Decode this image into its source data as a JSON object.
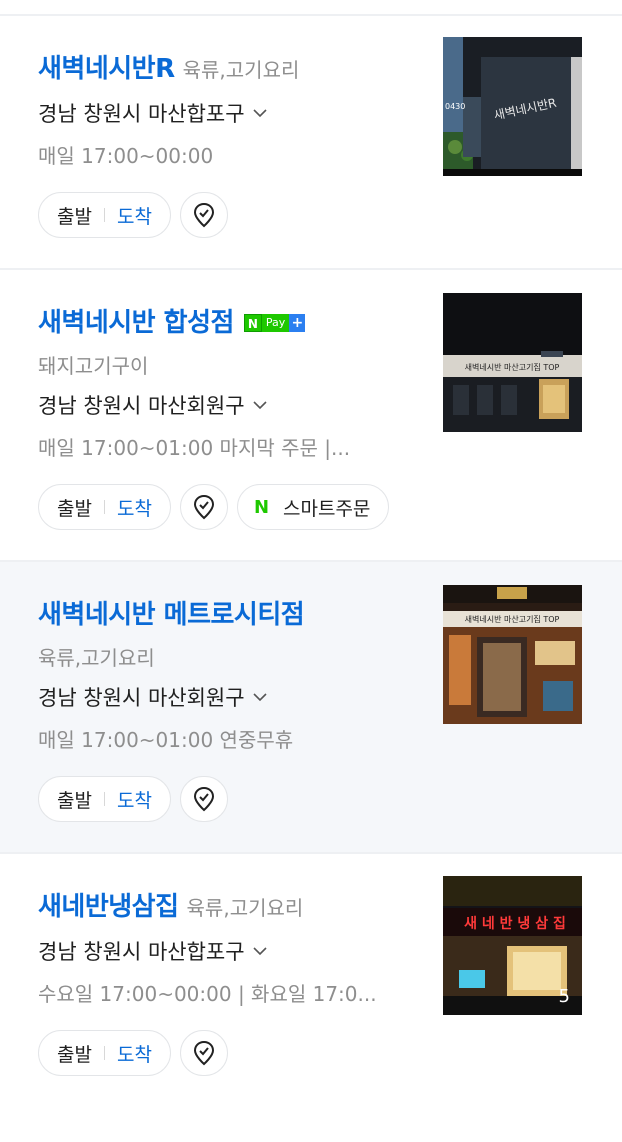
{
  "results": [
    {
      "name": "새벽네시반R",
      "category": "육류,고기요리",
      "address": "경남 창원시 마산합포구",
      "hours": "매일 17:00~00:00",
      "buttons": {
        "start": "출발",
        "arrive": "도착"
      },
      "thumbnail": {
        "sign_text": "새벽네시반R",
        "number_text": "0430"
      }
    },
    {
      "name": "새벽네시반 합성점",
      "badge": {
        "n": "N",
        "pay": "Pay",
        "plus": "+"
      },
      "category": "돼지고기구이",
      "address": "경남 창원시 마산회원구",
      "hours": "매일 17:00~01:00 마지막 주문 |...",
      "buttons": {
        "start": "출발",
        "arrive": "도착",
        "smart_order_logo": "N",
        "smart_order": "스마트주문"
      },
      "thumbnail": {
        "sign_text": "새벽네시반 마산고기집 TOP"
      }
    },
    {
      "name": "새벽네시반 메트로시티점",
      "category": "육류,고기요리",
      "address": "경남 창원시 마산회원구",
      "hours": "매일 17:00~01:00 연중무휴",
      "buttons": {
        "start": "출발",
        "arrive": "도착"
      },
      "thumbnail": {
        "sign_text": "새벽네시반 마산고기집 TOP"
      }
    },
    {
      "name": "새네반냉삼집",
      "category": "육류,고기요리",
      "address": "경남 창원시 마산합포구",
      "hours": "수요일 17:00~00:00 | 화요일 17:0...",
      "buttons": {
        "start": "출발",
        "arrive": "도착"
      },
      "thumbnail": {
        "sign_text": "새 네 반 냉 삼 집",
        "photo_count": "5"
      }
    }
  ],
  "icons": {
    "address_toggle": "chevron-down-icon",
    "map_pin": "map-pin-icon"
  },
  "colors": {
    "title": "#0a6ad6",
    "arrive": "#0a6ad6",
    "npay_green": "#1ec800",
    "highlight_bg": "#f5f7fa"
  }
}
